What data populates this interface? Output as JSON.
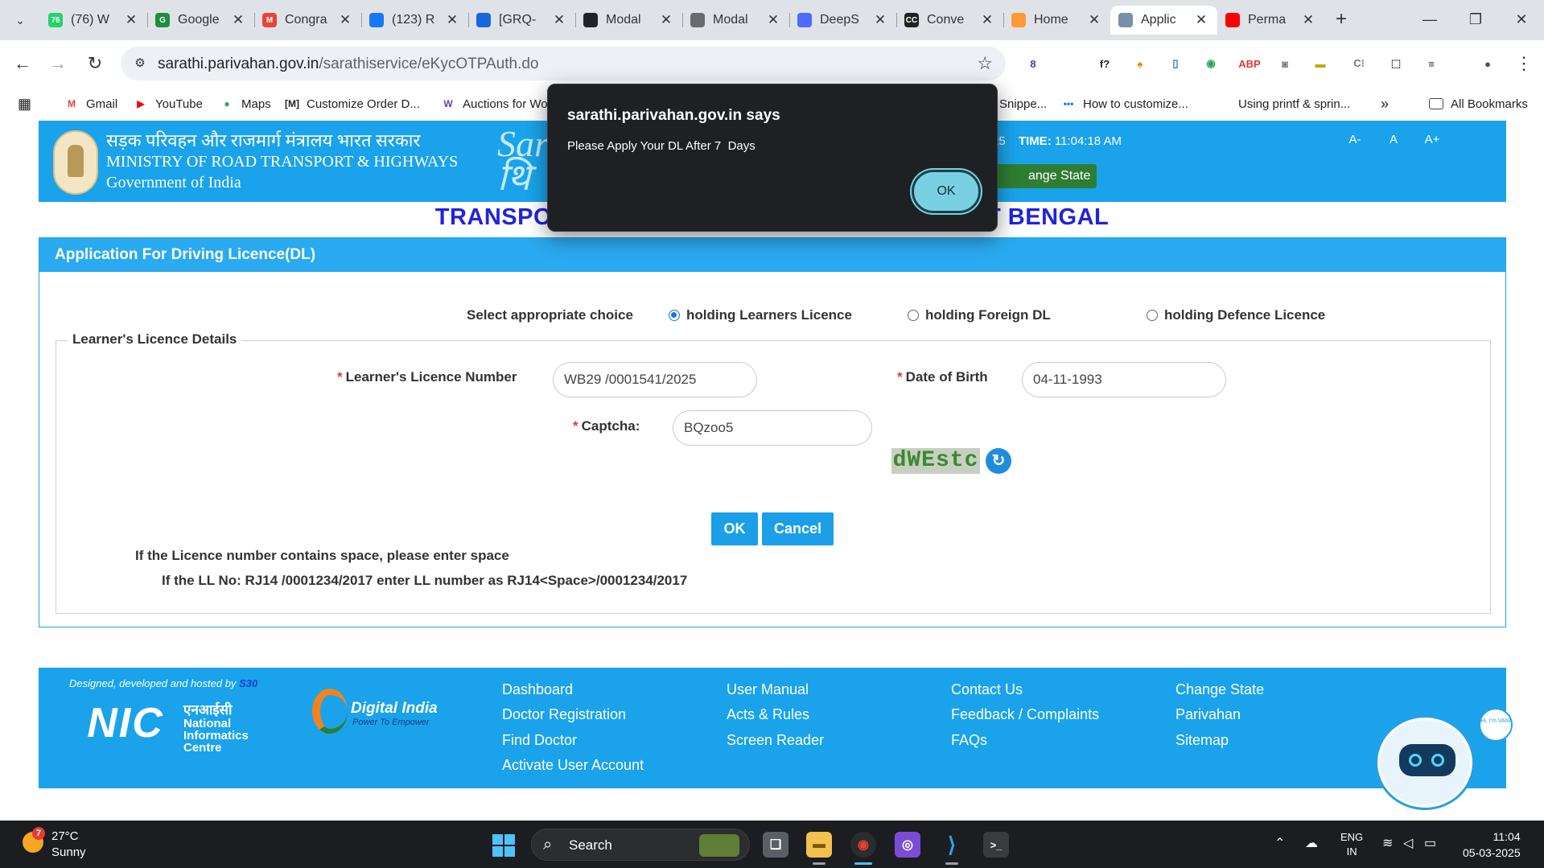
{
  "browser": {
    "tabs": [
      {
        "title": "(76) W",
        "favicon": "whatsapp-icon",
        "fav_text": "76",
        "color": "#25d366"
      },
      {
        "title": "Google",
        "favicon": "google-classroom-icon",
        "fav_text": "G",
        "color": "#1e8e3e"
      },
      {
        "title": "Congra",
        "favicon": "gmail-icon",
        "fav_text": "M",
        "color": "#ea4335"
      },
      {
        "title": "(123) R",
        "favicon": "butterfly-icon",
        "fav_text": "",
        "color": "#1877f2"
      },
      {
        "title": "[GRQ-",
        "favicon": "jira-icon",
        "fav_text": "",
        "color": "#1868db"
      },
      {
        "title": "Modal",
        "favicon": "react-icon",
        "fav_text": "",
        "color": "#20232a"
      },
      {
        "title": "Modal",
        "favicon": "chatgpt-icon",
        "fav_text": "",
        "color": "#6b6b6b"
      },
      {
        "title": "DeepS",
        "favicon": "deepseek-icon",
        "fav_text": "",
        "color": "#4d6bfe"
      },
      {
        "title": "Conve",
        "favicon": "cc-icon",
        "fav_text": "CC",
        "color": "#222222"
      },
      {
        "title": "Home",
        "favicon": "india-flag-icon",
        "fav_text": "",
        "color": "#ff9933"
      },
      {
        "title": "Applic",
        "favicon": "emblem-icon",
        "fav_text": "",
        "color": "#7a8fa8",
        "active": true
      },
      {
        "title": "Perma",
        "favicon": "youtube-icon",
        "fav_text": "",
        "color": "#ff0000"
      }
    ],
    "url_host": "sarathi.parivahan.gov.in",
    "url_path": "/sarathiservice/eKycOTPAuth.do",
    "extensions": [
      {
        "name": "extension-badge-icon",
        "text": "8",
        "color": "#3b3bd8"
      },
      {
        "name": "extension-blank-icon",
        "text": "",
        "color": "#e6e6e6"
      },
      {
        "name": "extension-fx-icon",
        "text": "f?",
        "color": "#222222"
      },
      {
        "name": "extension-fire-icon",
        "text": "♠",
        "color": "#f57c00"
      },
      {
        "name": "extension-doc-icon",
        "text": "▯",
        "color": "#2f6fdc"
      },
      {
        "name": "extension-eye-icon",
        "text": "◉",
        "color": "#1faa59"
      },
      {
        "name": "adblock-icon",
        "text": "ABP",
        "color": "#e53935"
      },
      {
        "name": "camera-icon",
        "text": "◙",
        "color": "#777777"
      },
      {
        "name": "extension-folder-icon",
        "text": "▬",
        "color": "#c8a400"
      },
      {
        "name": "extension-cs-icon",
        "text": "C⁝",
        "color": "#777777"
      },
      {
        "name": "puzzle-icon",
        "text": "⬚",
        "color": "#333333"
      },
      {
        "name": "media-icon",
        "text": "≡",
        "color": "#333333"
      },
      {
        "name": "profile-avatar-icon",
        "text": "●",
        "color": "#5a3e8a"
      }
    ],
    "bookmarks": [
      {
        "label": "Gmail",
        "icon": "gmail-icon",
        "glyph": "M",
        "color": "#ea4335"
      },
      {
        "label": "YouTube",
        "icon": "youtube-icon",
        "glyph": "▶",
        "color": "#ff0000"
      },
      {
        "label": "Maps",
        "icon": "maps-pin-icon",
        "glyph": "●",
        "color": "#34a853"
      },
      {
        "label": "Customize Order D...",
        "icon": "m-bracket-icon",
        "glyph": "[M]",
        "color": "#222222"
      },
      {
        "label": "Auctions for Wo",
        "icon": "w-icon",
        "glyph": "W",
        "color": "#6a3fa0"
      },
      {
        "label": "Snippe...",
        "icon": "snippet-icon",
        "glyph": "",
        "color": "#555555"
      },
      {
        "label": "How to customize...",
        "icon": "dots-icon",
        "glyph": "•••",
        "color": "#1a73e8"
      },
      {
        "label": "Using printf & sprin...",
        "icon": "thumbnail-icon",
        "glyph": "",
        "color": "#4a4a4a"
      }
    ],
    "all_bookmarks": "All Bookmarks"
  },
  "header": {
    "hindi": "सड़क परिवहन और राजमार्ग मंत्रालय भारत सरकार",
    "ministry": "MINISTRY OF ROAD TRANSPORT & HIGHWAYS",
    "gov": "Government of India",
    "logo_text": "Sar\nथि",
    "date_value": "25",
    "time_label": "TIME:",
    "time_value": "11:04:18 AM",
    "change_state": "ange State",
    "font_small": "A-",
    "font_normal": "A",
    "font_large": "A+"
  },
  "page": {
    "title_left": "TRANSPO",
    "title_right": "T BENGAL",
    "panel_title": "Application For Driving Licence(DL)",
    "choice_label": "Select appropriate choice",
    "choices": [
      "holding Learners Licence",
      "holding Foreign DL",
      "holding Defence Licence"
    ],
    "selected_choice": 0,
    "legend": "Learner's Licence Details",
    "ll_label": "Learner's Licence Number",
    "ll_value": "WB29 /0001541/2025",
    "dob_label": "Date of Birth",
    "dob_value": "04-11-1993",
    "captcha_label": "Captcha:",
    "captcha_value": "BQzoo5",
    "captcha_image_text": "dWEstc",
    "ok_button": "OK",
    "cancel_button": "Cancel",
    "note1": "If the Licence number contains space, please enter space",
    "note2": "If the LL No: RJ14 /0001234/2017 enter LL number as RJ14<Space>/0001234/2017"
  },
  "footer": {
    "designed": "Designed, developed and hosted by",
    "designed_org": "S30",
    "nic_short": "NIC",
    "nic_hindi": "एनआईसी",
    "nic_line1": "National",
    "nic_line2": "Informatics",
    "nic_line3": "Centre",
    "digital_india": "Digital India",
    "digital_tag": "Power To Empower",
    "col1": [
      "Dashboard",
      "Doctor Registration",
      "Find Doctor",
      "Activate User Account"
    ],
    "col2": [
      "User Manual",
      "Acts & Rules",
      "Screen Reader"
    ],
    "col3": [
      "Contact Us",
      "Feedback / Complaints",
      "FAQs"
    ],
    "col4": [
      "Change State",
      "Parivahan",
      "Sitemap"
    ],
    "chatbot_bubble": "Hi, I'm VANI"
  },
  "dialog": {
    "title": "sarathi.parivahan.gov.in says",
    "message": "Please Apply Your DL After 7  Days",
    "ok": "OK"
  },
  "taskbar": {
    "weather_badge": "7",
    "temp": "27°C",
    "condition": "Sunny",
    "search": "Search",
    "lang1": "ENG",
    "lang2": "IN",
    "time": "11:04",
    "date": "05-03-2025"
  }
}
